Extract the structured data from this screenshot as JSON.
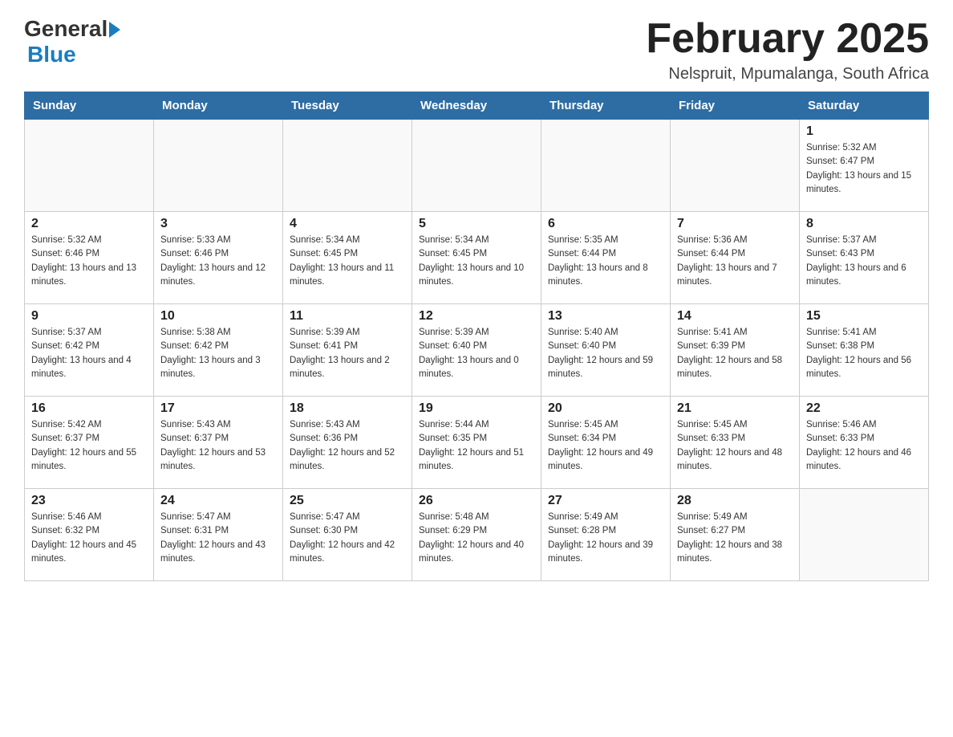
{
  "header": {
    "logo_general": "General",
    "logo_blue": "Blue",
    "title": "February 2025",
    "subtitle": "Nelspruit, Mpumalanga, South Africa"
  },
  "days_of_week": [
    "Sunday",
    "Monday",
    "Tuesday",
    "Wednesday",
    "Thursday",
    "Friday",
    "Saturday"
  ],
  "weeks": [
    [
      {
        "day": "",
        "info": []
      },
      {
        "day": "",
        "info": []
      },
      {
        "day": "",
        "info": []
      },
      {
        "day": "",
        "info": []
      },
      {
        "day": "",
        "info": []
      },
      {
        "day": "",
        "info": []
      },
      {
        "day": "1",
        "info": [
          "Sunrise: 5:32 AM",
          "Sunset: 6:47 PM",
          "Daylight: 13 hours and 15 minutes."
        ]
      }
    ],
    [
      {
        "day": "2",
        "info": [
          "Sunrise: 5:32 AM",
          "Sunset: 6:46 PM",
          "Daylight: 13 hours and 13 minutes."
        ]
      },
      {
        "day": "3",
        "info": [
          "Sunrise: 5:33 AM",
          "Sunset: 6:46 PM",
          "Daylight: 13 hours and 12 minutes."
        ]
      },
      {
        "day": "4",
        "info": [
          "Sunrise: 5:34 AM",
          "Sunset: 6:45 PM",
          "Daylight: 13 hours and 11 minutes."
        ]
      },
      {
        "day": "5",
        "info": [
          "Sunrise: 5:34 AM",
          "Sunset: 6:45 PM",
          "Daylight: 13 hours and 10 minutes."
        ]
      },
      {
        "day": "6",
        "info": [
          "Sunrise: 5:35 AM",
          "Sunset: 6:44 PM",
          "Daylight: 13 hours and 8 minutes."
        ]
      },
      {
        "day": "7",
        "info": [
          "Sunrise: 5:36 AM",
          "Sunset: 6:44 PM",
          "Daylight: 13 hours and 7 minutes."
        ]
      },
      {
        "day": "8",
        "info": [
          "Sunrise: 5:37 AM",
          "Sunset: 6:43 PM",
          "Daylight: 13 hours and 6 minutes."
        ]
      }
    ],
    [
      {
        "day": "9",
        "info": [
          "Sunrise: 5:37 AM",
          "Sunset: 6:42 PM",
          "Daylight: 13 hours and 4 minutes."
        ]
      },
      {
        "day": "10",
        "info": [
          "Sunrise: 5:38 AM",
          "Sunset: 6:42 PM",
          "Daylight: 13 hours and 3 minutes."
        ]
      },
      {
        "day": "11",
        "info": [
          "Sunrise: 5:39 AM",
          "Sunset: 6:41 PM",
          "Daylight: 13 hours and 2 minutes."
        ]
      },
      {
        "day": "12",
        "info": [
          "Sunrise: 5:39 AM",
          "Sunset: 6:40 PM",
          "Daylight: 13 hours and 0 minutes."
        ]
      },
      {
        "day": "13",
        "info": [
          "Sunrise: 5:40 AM",
          "Sunset: 6:40 PM",
          "Daylight: 12 hours and 59 minutes."
        ]
      },
      {
        "day": "14",
        "info": [
          "Sunrise: 5:41 AM",
          "Sunset: 6:39 PM",
          "Daylight: 12 hours and 58 minutes."
        ]
      },
      {
        "day": "15",
        "info": [
          "Sunrise: 5:41 AM",
          "Sunset: 6:38 PM",
          "Daylight: 12 hours and 56 minutes."
        ]
      }
    ],
    [
      {
        "day": "16",
        "info": [
          "Sunrise: 5:42 AM",
          "Sunset: 6:37 PM",
          "Daylight: 12 hours and 55 minutes."
        ]
      },
      {
        "day": "17",
        "info": [
          "Sunrise: 5:43 AM",
          "Sunset: 6:37 PM",
          "Daylight: 12 hours and 53 minutes."
        ]
      },
      {
        "day": "18",
        "info": [
          "Sunrise: 5:43 AM",
          "Sunset: 6:36 PM",
          "Daylight: 12 hours and 52 minutes."
        ]
      },
      {
        "day": "19",
        "info": [
          "Sunrise: 5:44 AM",
          "Sunset: 6:35 PM",
          "Daylight: 12 hours and 51 minutes."
        ]
      },
      {
        "day": "20",
        "info": [
          "Sunrise: 5:45 AM",
          "Sunset: 6:34 PM",
          "Daylight: 12 hours and 49 minutes."
        ]
      },
      {
        "day": "21",
        "info": [
          "Sunrise: 5:45 AM",
          "Sunset: 6:33 PM",
          "Daylight: 12 hours and 48 minutes."
        ]
      },
      {
        "day": "22",
        "info": [
          "Sunrise: 5:46 AM",
          "Sunset: 6:33 PM",
          "Daylight: 12 hours and 46 minutes."
        ]
      }
    ],
    [
      {
        "day": "23",
        "info": [
          "Sunrise: 5:46 AM",
          "Sunset: 6:32 PM",
          "Daylight: 12 hours and 45 minutes."
        ]
      },
      {
        "day": "24",
        "info": [
          "Sunrise: 5:47 AM",
          "Sunset: 6:31 PM",
          "Daylight: 12 hours and 43 minutes."
        ]
      },
      {
        "day": "25",
        "info": [
          "Sunrise: 5:47 AM",
          "Sunset: 6:30 PM",
          "Daylight: 12 hours and 42 minutes."
        ]
      },
      {
        "day": "26",
        "info": [
          "Sunrise: 5:48 AM",
          "Sunset: 6:29 PM",
          "Daylight: 12 hours and 40 minutes."
        ]
      },
      {
        "day": "27",
        "info": [
          "Sunrise: 5:49 AM",
          "Sunset: 6:28 PM",
          "Daylight: 12 hours and 39 minutes."
        ]
      },
      {
        "day": "28",
        "info": [
          "Sunrise: 5:49 AM",
          "Sunset: 6:27 PM",
          "Daylight: 12 hours and 38 minutes."
        ]
      },
      {
        "day": "",
        "info": []
      }
    ]
  ]
}
